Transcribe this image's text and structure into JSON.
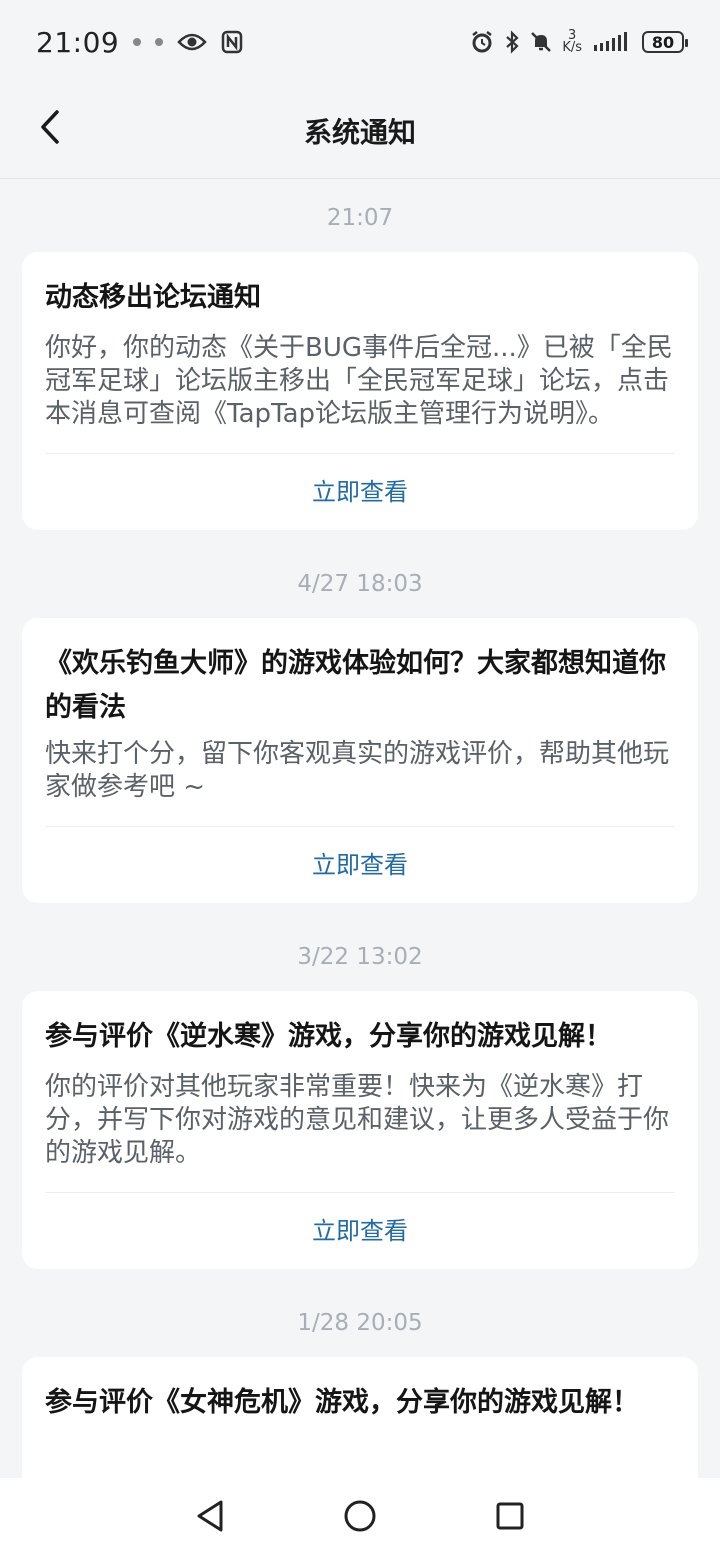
{
  "status_bar": {
    "time": "21:09",
    "net_speed_value": "3",
    "net_speed_unit": "K/s",
    "battery": "80",
    "icons": [
      "eye-icon",
      "nfc-icon",
      "alarm-icon",
      "bluetooth-icon",
      "mute-icon",
      "signal-icon",
      "battery-icon"
    ]
  },
  "header": {
    "title": "系统通知",
    "back_icon": "chevron-left-icon"
  },
  "notifications": [
    {
      "time": "21:07",
      "title": "动态移出论坛通知",
      "body": "你好，你的动态《关于BUG事件后全冠...》已被「全民冠军足球」论坛版主移出「全民冠军足球」论坛，点击本消息可查阅《TapTap论坛版主管理行为说明》。",
      "action": "立即查看"
    },
    {
      "time": "4/27  18:03",
      "title": "《欢乐钓鱼大师》的游戏体验如何？大家都想知道你的看法",
      "body": "快来打个分，留下你客观真实的游戏评价，帮助其他玩家做参考吧 ~",
      "action": "立即查看"
    },
    {
      "time": "3/22  13:02",
      "title": "参与评价《逆水寒》游戏，分享你的游戏见解！",
      "body": "你的评价对其他玩家非常重要！快来为《逆水寒》打分，并写下你对游戏的意见和建议，让更多人受益于你的游戏见解。",
      "action": "立即查看"
    },
    {
      "time": "1/28  20:05",
      "title": "参与评价《女神危机》游戏，分享你的游戏见解！",
      "body": "",
      "action": ""
    }
  ],
  "nav_bar": {
    "back_icon": "triangle-back-icon",
    "home_icon": "circle-home-icon",
    "recents_icon": "square-recents-icon"
  }
}
